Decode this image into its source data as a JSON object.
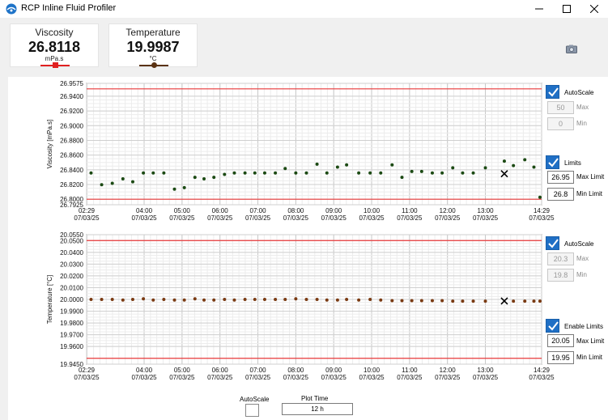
{
  "window": {
    "title": "RCP Inline Fluid Profiler",
    "controls": [
      "minimize",
      "maximize",
      "close"
    ]
  },
  "readouts": {
    "viscosity": {
      "label": "Viscosity",
      "value": "26.8118",
      "unit": "mPa.s",
      "color": "#e02020"
    },
    "temperature": {
      "label": "Temperature",
      "value": "19.9987",
      "unit": "°C",
      "color": "#5a3212"
    }
  },
  "viscosity_controls": {
    "autoscale_label": "AutoScale",
    "autoscale_checked": true,
    "max_value": "50",
    "max_label": "Max",
    "min_value": "0",
    "min_label": "Min",
    "limits_label": "Limits",
    "limits_checked": true,
    "max_limit_value": "26.95",
    "max_limit_label": "Max Limit",
    "min_limit_value": "26.8",
    "min_limit_label": "Min Limit"
  },
  "temperature_controls": {
    "autoscale_label": "AutoScale",
    "autoscale_checked": true,
    "max_value": "20.3",
    "max_label": "Max",
    "min_value": "19.8",
    "min_label": "Min",
    "limits_label": "Enable Limits",
    "limits_checked": true,
    "max_limit_value": "20.05",
    "max_limit_label": "Max Limit",
    "min_limit_value": "19.95",
    "min_limit_label": "Min Limit"
  },
  "bottom_controls": {
    "autoscale_label": "AutoScale",
    "autoscale_checked": false,
    "plot_time_label": "Plot Time",
    "plot_time_value": "12 h"
  },
  "colors": {
    "limit_line": "#e8393a",
    "accent_checkbox": "#1f6fc5",
    "viscosity_point": "#1c4a14",
    "temperature_point": "#7a3a12"
  },
  "chart_data": [
    {
      "type": "scatter",
      "ylabel": "Viscosity [mPa.s]",
      "ylim": [
        26.7925,
        26.9575
      ],
      "yticks": [
        "26.9575",
        "26.9400",
        "26.9200",
        "26.9000",
        "26.8800",
        "26.8600",
        "26.8400",
        "26.8200",
        "26.8000",
        "26.7925"
      ],
      "x_start_hour": 2.4833,
      "x_end_hour": 14.4833,
      "xticks": [
        {
          "hour": 2.4833,
          "time": "02:29",
          "date": "07/03/25"
        },
        {
          "hour": 4,
          "time": "04:00",
          "date": "07/03/25"
        },
        {
          "hour": 5,
          "time": "05:00",
          "date": "07/03/25"
        },
        {
          "hour": 6,
          "time": "06:00",
          "date": "07/03/25"
        },
        {
          "hour": 7,
          "time": "07:00",
          "date": "07/03/25"
        },
        {
          "hour": 8,
          "time": "08:00",
          "date": "07/03/25"
        },
        {
          "hour": 9,
          "time": "09:00",
          "date": "07/03/25"
        },
        {
          "hour": 10,
          "time": "10:00",
          "date": "07/03/25"
        },
        {
          "hour": 11,
          "time": "11:00",
          "date": "07/03/25"
        },
        {
          "hour": 12,
          "time": "12:00",
          "date": "07/03/25"
        },
        {
          "hour": 13,
          "time": "13:00",
          "date": "07/03/25"
        },
        {
          "hour": 14.4833,
          "time": "14:29",
          "date": "07/03/25"
        }
      ],
      "limits": {
        "max": 26.95,
        "min": 26.8
      },
      "cursor": {
        "hour": 13.5,
        "value": 26.8347
      },
      "x": [
        2.6,
        2.88,
        3.16,
        3.44,
        3.7,
        3.98,
        4.24,
        4.52,
        4.8,
        5.06,
        5.34,
        5.58,
        5.84,
        6.12,
        6.38,
        6.66,
        6.92,
        7.18,
        7.46,
        7.72,
        8.0,
        8.28,
        8.56,
        8.82,
        9.1,
        9.34,
        9.66,
        9.96,
        10.24,
        10.54,
        10.8,
        11.06,
        11.32,
        11.6,
        11.86,
        12.14,
        12.4,
        12.68,
        13.0,
        13.5,
        13.74,
        14.04,
        14.28,
        14.44
      ],
      "y": [
        26.8357,
        26.8197,
        26.8217,
        26.8277,
        26.8237,
        26.8357,
        26.8357,
        26.8357,
        26.8137,
        26.8157,
        26.8297,
        26.8277,
        26.8297,
        26.8337,
        26.8357,
        26.8357,
        26.8357,
        26.8357,
        26.8357,
        26.8417,
        26.8357,
        26.8357,
        26.8477,
        26.8357,
        26.8437,
        26.8467,
        26.8357,
        26.8357,
        26.8357,
        26.8467,
        26.8297,
        26.8377,
        26.8377,
        26.8357,
        26.8357,
        26.8427,
        26.8357,
        26.8357,
        26.8427,
        26.8517,
        26.8457,
        26.8537,
        26.8437,
        26.8027,
        26.8117,
        26.8117
      ],
      "x_points_note_removed": true
    },
    {
      "type": "scatter",
      "ylabel": "Temperature [°C]",
      "ylim": [
        19.945,
        20.055
      ],
      "yticks": [
        "20.0550",
        "20.0500",
        "20.0400",
        "20.0300",
        "20.0200",
        "20.0100",
        "20.0000",
        "19.9900",
        "19.9800",
        "19.9700",
        "19.9600",
        "19.9450"
      ],
      "x_start_hour": 2.4833,
      "x_end_hour": 14.4833,
      "limits": {
        "max": 20.05,
        "min": 19.95
      },
      "cursor": {
        "hour": 13.5,
        "value": 19.9987
      },
      "x": [
        2.6,
        2.88,
        3.16,
        3.44,
        3.7,
        3.98,
        4.24,
        4.52,
        4.8,
        5.06,
        5.34,
        5.58,
        5.84,
        6.12,
        6.38,
        6.66,
        6.92,
        7.18,
        7.46,
        7.72,
        8.0,
        8.28,
        8.56,
        8.82,
        9.1,
        9.34,
        9.66,
        9.96,
        10.24,
        10.54,
        10.8,
        11.06,
        11.32,
        11.6,
        11.86,
        12.14,
        12.4,
        12.68,
        13.0,
        13.74,
        14.04,
        14.28,
        14.44
      ],
      "y": [
        20.0,
        20.0,
        20.0,
        19.9995,
        20.0,
        20.0005,
        19.9995,
        20.0,
        19.9995,
        19.9995,
        20.0005,
        19.9995,
        19.9995,
        20.0,
        19.9995,
        20.0,
        20.0,
        20.0,
        20.0,
        20.0,
        20.0005,
        20.0,
        20.0,
        19.9995,
        19.9995,
        20.0,
        19.9995,
        20.0,
        19.9995,
        19.999,
        19.999,
        19.999,
        19.999,
        19.999,
        19.999,
        19.9985,
        19.9985,
        19.9985,
        19.9985,
        19.9985,
        19.9985,
        19.9985,
        19.9985
      ]
    }
  ]
}
